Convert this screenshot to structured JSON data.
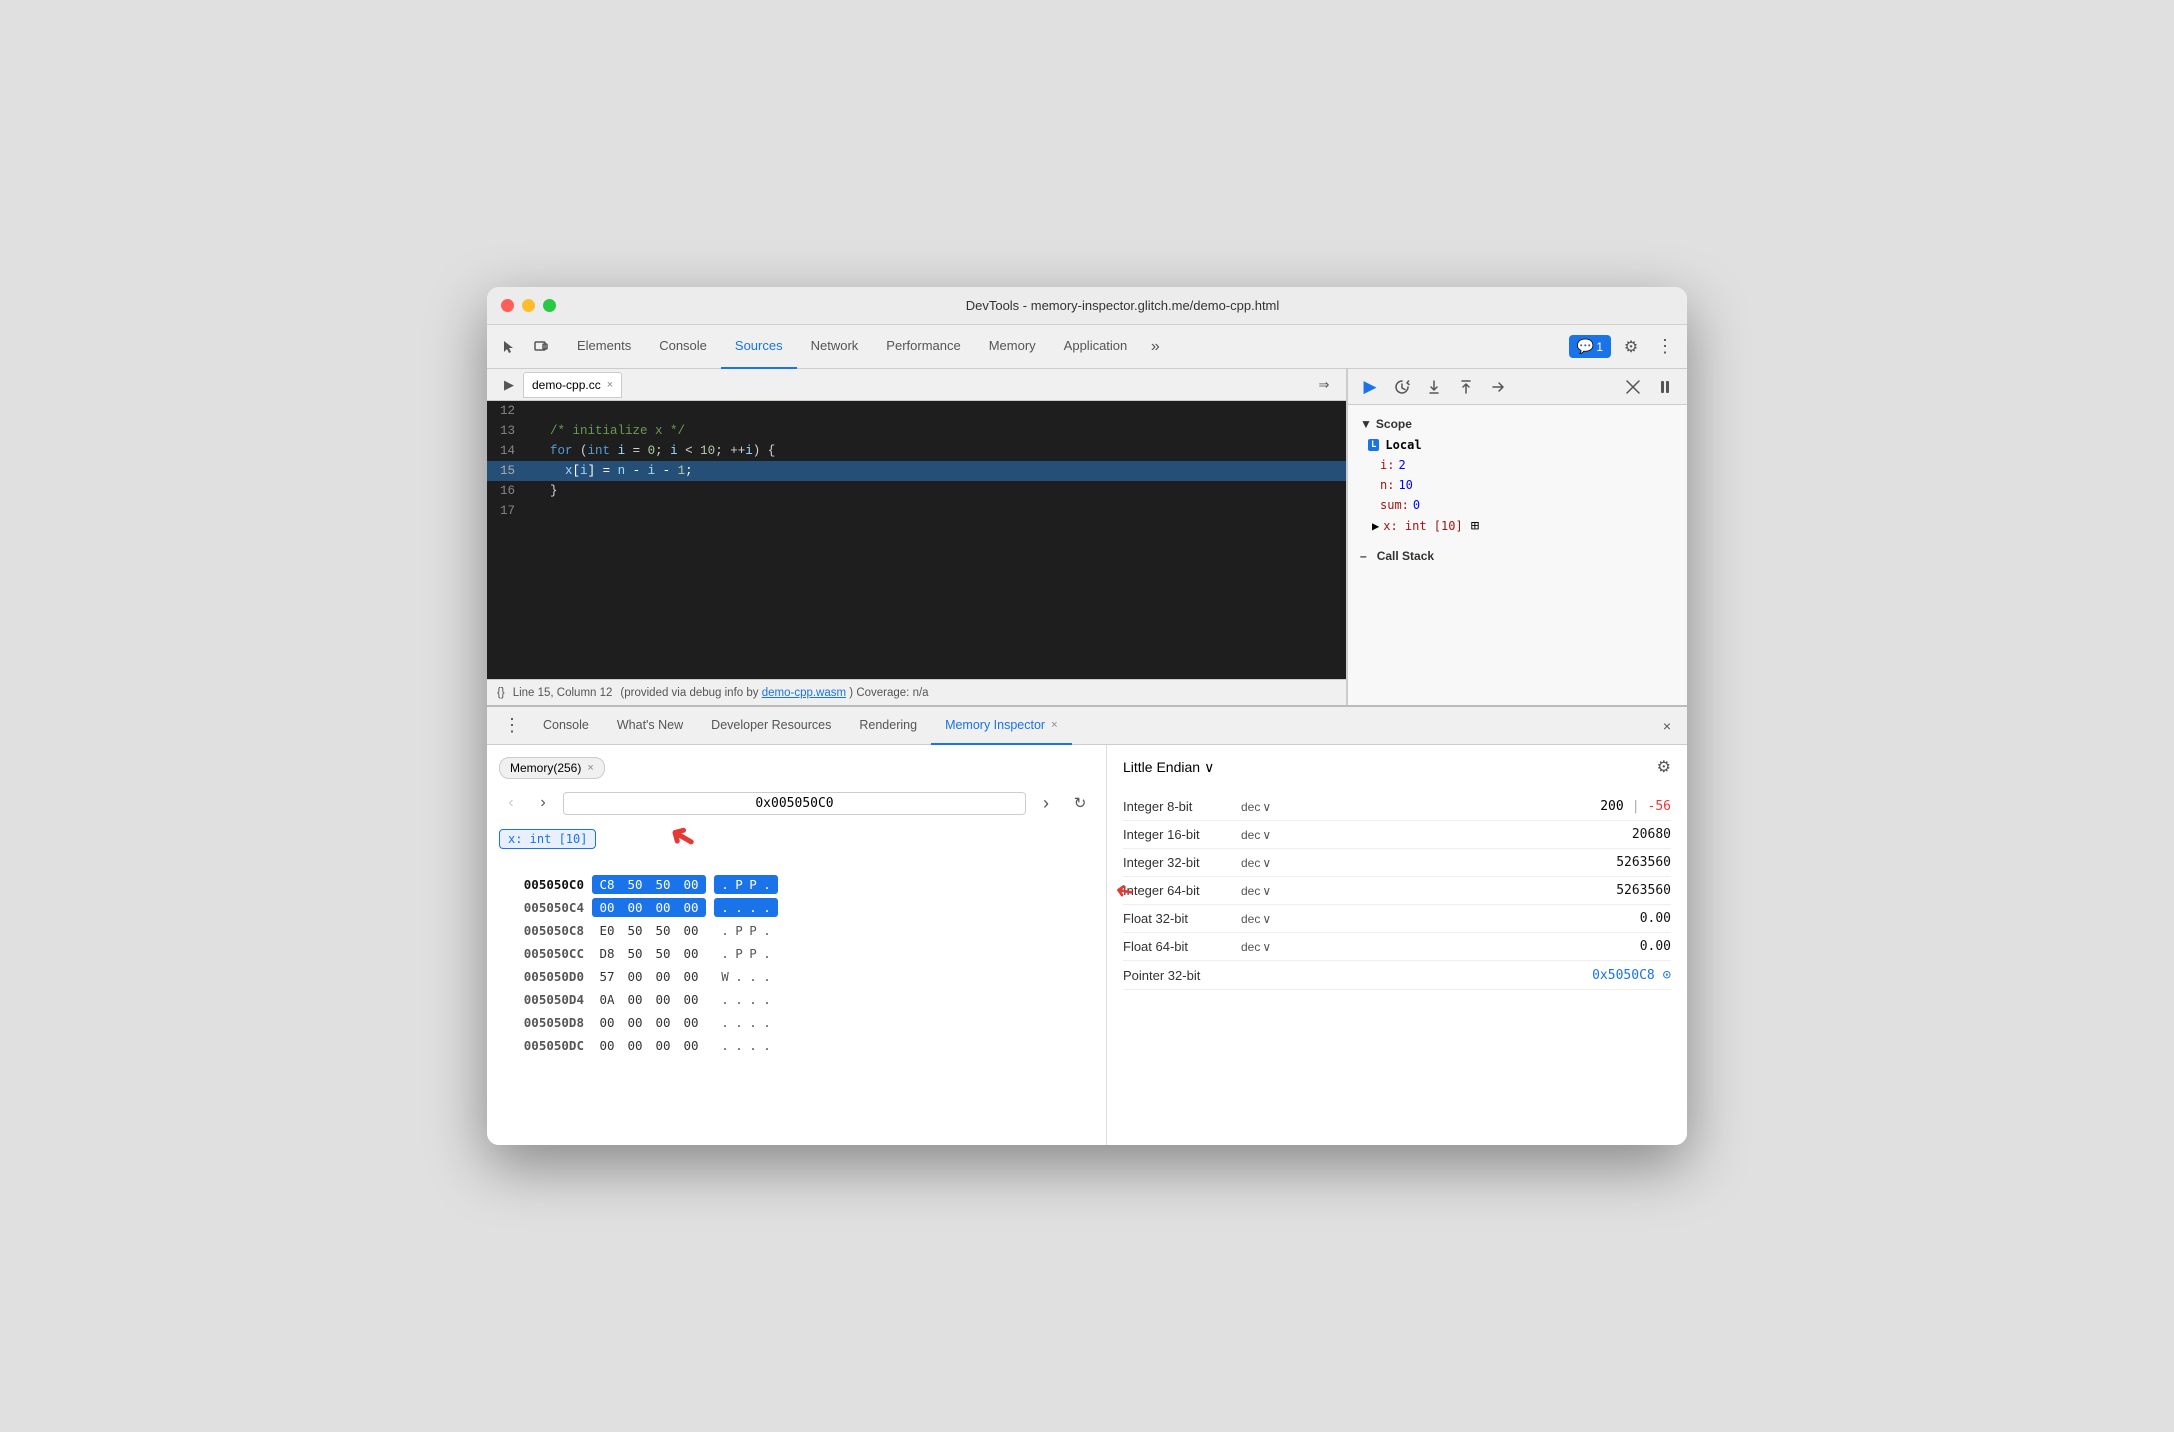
{
  "window": {
    "title": "DevTools - memory-inspector.glitch.me/demo-cpp.html",
    "traffic_lights": [
      "red",
      "yellow",
      "green"
    ]
  },
  "top_nav": {
    "tabs": [
      {
        "label": "Elements",
        "active": false
      },
      {
        "label": "Console",
        "active": false
      },
      {
        "label": "Sources",
        "active": true
      },
      {
        "label": "Network",
        "active": false
      },
      {
        "label": "Performance",
        "active": false
      },
      {
        "label": "Memory",
        "active": false
      },
      {
        "label": "Application",
        "active": false
      }
    ],
    "more_icon": "»",
    "badge_count": "1",
    "settings_icon": "⚙",
    "more_menu_icon": "⋮"
  },
  "sources_panel": {
    "file_tab": {
      "name": "demo-cpp.cc",
      "close": "×"
    },
    "code_lines": [
      {
        "num": "12",
        "content": "",
        "highlighted": false
      },
      {
        "num": "13",
        "content": "  /* initialize x */",
        "highlighted": false,
        "type": "comment"
      },
      {
        "num": "14",
        "content": "  for (int i = 0; i < 10; ++i) {",
        "highlighted": false,
        "type": "code"
      },
      {
        "num": "15",
        "content": "    x[i] = n - i - 1;",
        "highlighted": true,
        "type": "code"
      },
      {
        "num": "16",
        "content": "  }",
        "highlighted": false
      },
      {
        "num": "17",
        "content": "",
        "highlighted": false
      }
    ],
    "status_bar": {
      "brace": "{}",
      "position": "Line 15, Column 12",
      "info": "(provided via debug info by",
      "link": "demo-cpp.wasm",
      "coverage": ") Coverage: n/a"
    }
  },
  "debug_toolbar": {
    "buttons": [
      {
        "icon": "▶",
        "name": "resume",
        "active": true
      },
      {
        "icon": "↻",
        "name": "step-over"
      },
      {
        "icon": "↓",
        "name": "step-into"
      },
      {
        "icon": "↑",
        "name": "step-out"
      },
      {
        "icon": "⇒",
        "name": "step"
      },
      {
        "icon": "✏",
        "name": "deactivate"
      },
      {
        "icon": "⏸",
        "name": "pause-on-exceptions"
      }
    ]
  },
  "scope_panel": {
    "header": "▼ Scope",
    "local_section": "Local",
    "variables": [
      {
        "key": "i:",
        "value": "2"
      },
      {
        "key": "n:",
        "value": "10"
      },
      {
        "key": "sum:",
        "value": "0"
      },
      {
        "key": "▶ x: int [10]",
        "value": "",
        "has_icon": true
      }
    ],
    "call_stack_header": "▼ Call Stack"
  },
  "bottom_panel": {
    "tabs": [
      {
        "label": "Console",
        "active": false
      },
      {
        "label": "What's New",
        "active": false
      },
      {
        "label": "Developer Resources",
        "active": false
      },
      {
        "label": "Rendering",
        "active": false
      },
      {
        "label": "Memory Inspector",
        "active": true,
        "closeable": true
      }
    ],
    "close_all": "×"
  },
  "memory_inspector": {
    "tab": "Memory(256)",
    "nav": {
      "back_disabled": true,
      "forward_disabled": false,
      "address": "0x005050C0",
      "forward_arrow": "›",
      "refresh_icon": "↻"
    },
    "badge": "x: int [10]",
    "rows": [
      {
        "addr": "005050C0",
        "bytes": [
          "C8",
          "50",
          "50",
          "00"
        ],
        "ascii": [
          ".",
          "P",
          "P",
          "."
        ],
        "selected": true
      },
      {
        "addr": "005050C4",
        "bytes": [
          "00",
          "00",
          "00",
          "00"
        ],
        "ascii": [
          ".",
          ".",
          ".",
          "."
        ],
        "selected": true
      },
      {
        "addr": "005050C8",
        "bytes": [
          "E0",
          "50",
          "50",
          "00"
        ],
        "ascii": [
          ".",
          "P",
          "P",
          "."
        ]
      },
      {
        "addr": "005050CC",
        "bytes": [
          "D8",
          "50",
          "50",
          "00"
        ],
        "ascii": [
          ".",
          "P",
          "P",
          "."
        ]
      },
      {
        "addr": "005050D0",
        "bytes": [
          "57",
          "00",
          "00",
          "00"
        ],
        "ascii": [
          "W",
          ".",
          ".",
          "."
        ]
      },
      {
        "addr": "005050D4",
        "bytes": [
          "0A",
          "00",
          "00",
          "00"
        ],
        "ascii": [
          ".",
          ".",
          ".",
          "."
        ]
      },
      {
        "addr": "005050D8",
        "bytes": [
          "00",
          "00",
          "00",
          "00"
        ],
        "ascii": [
          ".",
          ".",
          ".",
          "."
        ]
      },
      {
        "addr": "005050DC",
        "bytes": [
          "00",
          "00",
          "00",
          "00"
        ],
        "ascii": [
          ".",
          ".",
          ".",
          "."
        ]
      }
    ]
  },
  "value_inspector": {
    "endian": "Little Endian",
    "endian_icon": "∨",
    "settings_icon": "⚙",
    "types": [
      {
        "label": "Integer 8-bit",
        "format": "dec",
        "value": "200 | -56",
        "split": true
      },
      {
        "label": "Integer 16-bit",
        "format": "dec",
        "value": "20680"
      },
      {
        "label": "Integer 32-bit",
        "format": "dec",
        "value": "5263560"
      },
      {
        "label": "Integer 64-bit",
        "format": "dec",
        "value": "5263560"
      },
      {
        "label": "Float 32-bit",
        "format": "dec",
        "value": "0.00"
      },
      {
        "label": "Float 64-bit",
        "format": "dec",
        "value": "0.00"
      },
      {
        "label": "Pointer 32-bit",
        "format": "",
        "value": "0x5050C8",
        "pointer": true
      }
    ]
  }
}
